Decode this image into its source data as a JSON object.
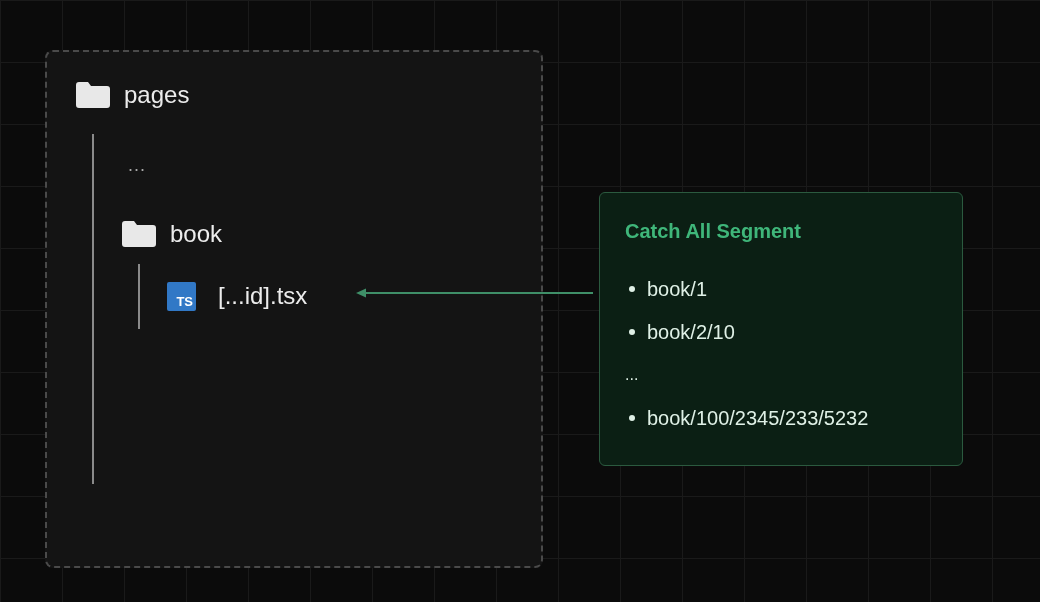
{
  "tree": {
    "name": "pages",
    "kind": "folder",
    "children": [
      {
        "name": "...",
        "kind": "ellipsis"
      },
      {
        "name": "book",
        "kind": "folder",
        "children": [
          {
            "name": "[...id].tsx",
            "kind": "ts-file",
            "badge": "TS"
          }
        ]
      }
    ]
  },
  "card": {
    "title": "Catch All Segment",
    "items": [
      {
        "kind": "bullet",
        "text": "book/1"
      },
      {
        "kind": "bullet",
        "text": "book/2/10"
      },
      {
        "kind": "ellipsis",
        "text": "..."
      },
      {
        "kind": "bullet",
        "text": "book/100/2345/233/5232"
      }
    ]
  }
}
